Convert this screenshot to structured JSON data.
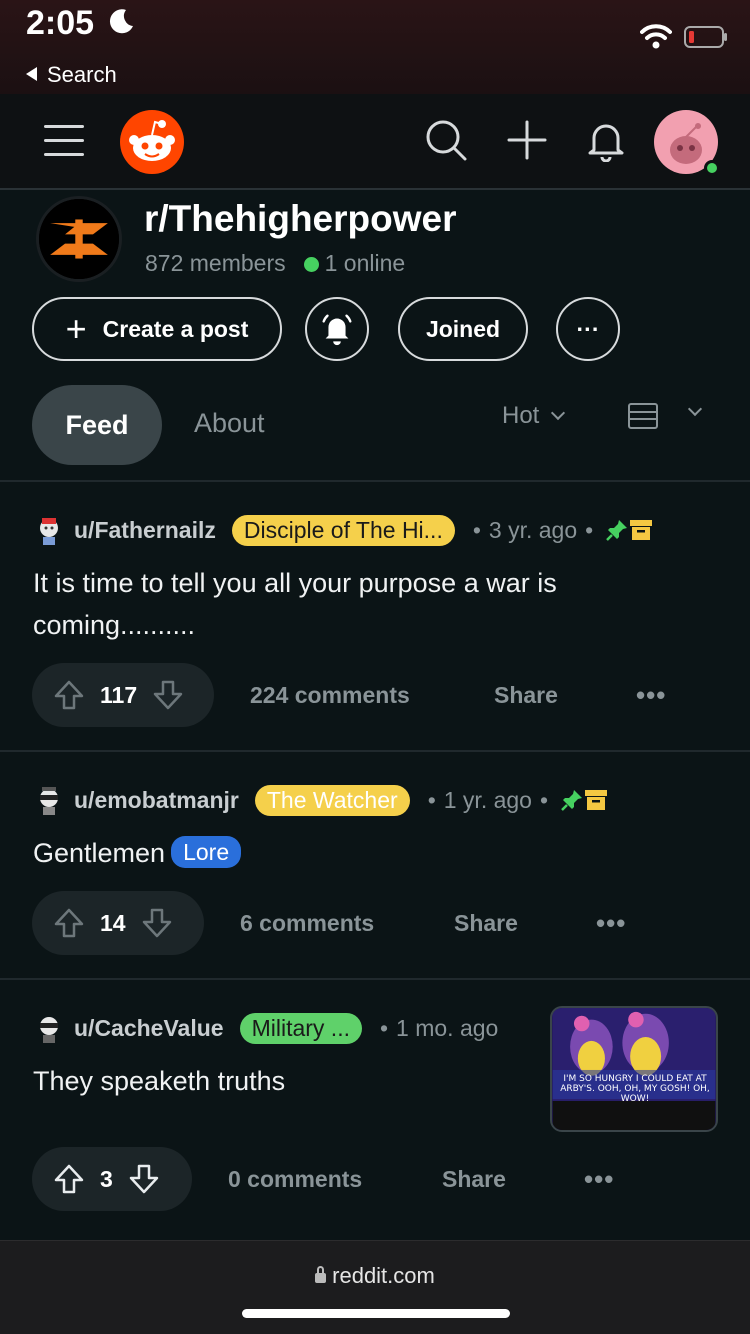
{
  "status_bar": {
    "time": "2:05",
    "back_label": "Search"
  },
  "header": {
    "icons": [
      "menu-icon",
      "reddit-logo",
      "search-icon",
      "plus-icon",
      "bell-icon",
      "avatar"
    ]
  },
  "subreddit": {
    "name": "r/Thehigherpower",
    "members": "872 members",
    "online": "1 online",
    "create_post_label": "Create a post",
    "joined_label": "Joined",
    "more_label": "···"
  },
  "tabs": {
    "feed": "Feed",
    "about": "About",
    "sort": "Hot"
  },
  "posts": [
    {
      "username": "u/Fathernailz",
      "flair": "Disciple of The Hi...",
      "flair_color": "#f5d04b",
      "age": "3 yr. ago",
      "title_line1": "It is time to tell you all your purpose a war is",
      "title_line2": "coming..........",
      "votes": "117",
      "comments": "224 comments",
      "share": "Share",
      "more": "•••"
    },
    {
      "username": "u/emobatmanjr",
      "flair": "The Watcher",
      "flair_color": "#f5d04b",
      "age": "1 yr. ago",
      "title": "Gentlemen",
      "tag": "Lore",
      "votes": "14",
      "comments": "6 comments",
      "share": "Share",
      "more": "•••"
    },
    {
      "username": "u/CacheValue",
      "flair": "Military ...",
      "flair_color": "#5fd16a",
      "age": "1 mo. ago",
      "title": "They speaketh truths",
      "thumb_caption": "I'M SO HUNGRY I COULD EAT AT ARBY'S. OOH, OH, MY GOSH! OH, WOW!",
      "votes": "3",
      "comments": "0 comments",
      "share": "Share",
      "more": "•••"
    }
  ],
  "browser": {
    "url": "reddit.com"
  },
  "colors": {
    "background": "#0b1416",
    "online": "#46d160",
    "pin": "#46d160",
    "archive": "#f5c842",
    "lore_tag": "#2a6fdb"
  }
}
